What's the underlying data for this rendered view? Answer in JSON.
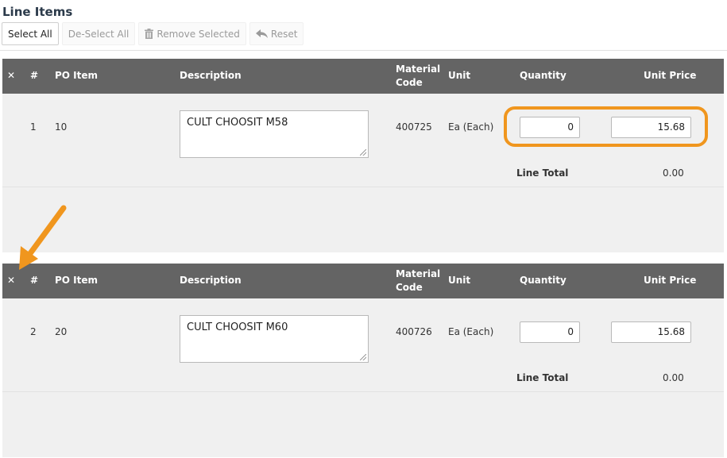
{
  "section": {
    "title": "Line Items"
  },
  "toolbar": {
    "select_all": "Select All",
    "deselect_all": "De-Select All",
    "remove_selected": "Remove Selected",
    "reset": "Reset"
  },
  "columns": {
    "remove": "✕",
    "num": "#",
    "po_item": "PO Item",
    "description": "Description",
    "material_code_line1": "Material",
    "material_code_line2": "Code",
    "unit": "Unit",
    "quantity": "Quantity",
    "unit_price": "Unit Price"
  },
  "line_total_label": "Line Total",
  "lines": [
    {
      "num": "1",
      "po_item": "10",
      "description": "CULT CHOOSIT M58",
      "material_code": "400725",
      "unit": "Ea (Each)",
      "quantity": "0",
      "unit_price": "15.68",
      "line_total": "0.00"
    },
    {
      "num": "2",
      "po_item": "20",
      "description": "CULT CHOOSIT M60",
      "material_code": "400726",
      "unit": "Ea (Each)",
      "quantity": "0",
      "unit_price": "15.68",
      "line_total": "0.00"
    }
  ],
  "colors": {
    "header_bg": "#646464",
    "row_bg": "#f0f0f0",
    "annotation": "#f0961e"
  }
}
